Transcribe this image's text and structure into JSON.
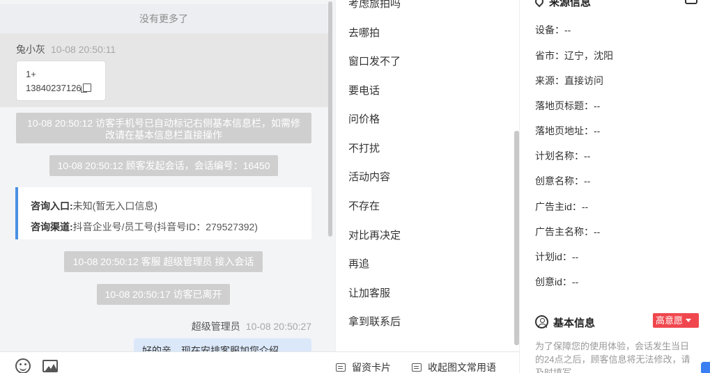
{
  "chat": {
    "no_more": "没有更多了",
    "visitor_message": {
      "sender": "兔小灰",
      "time": "10-08 20:50:11",
      "line1": "1+",
      "line2": "13840237126"
    },
    "system_messages": [
      "10-08 20:50:12 访客手机号已自动标记右侧基本信息栏，如需修改请在基本信息栏直接操作",
      "10-08 20:50:12 顾客发起会话，会话编号：16450",
      "10-08 20:50:12 客服 超级管理员 接入会话",
      "10-08 20:50:17 访客已离开"
    ],
    "info_card": {
      "entry_label": "咨询入口:",
      "entry_value": "未知(暂无入口信息)",
      "channel_label": "咨询渠道:",
      "channel_value": "抖音企业号/员工号(抖音号ID：279527392)"
    },
    "agent_message": {
      "sender": "超级管理员",
      "time": "10-08 20:50:27",
      "text": "好的亲，现在安排客服加您介绍"
    }
  },
  "toolbar": {
    "emoji_icon": "emoji-icon",
    "image_icon": "image-icon",
    "card_label": "留资卡片",
    "collapse_label": "收起图文常用语"
  },
  "quick_replies": [
    "考虑旅拍吗",
    "去哪拍",
    "窗口发不了",
    "要电话",
    "问价格",
    "不打扰",
    "活动内容",
    "不存在",
    "对比再决定",
    "再追",
    "让加客服",
    "拿到联系后"
  ],
  "source_info": {
    "title": "来源信息",
    "rows": [
      "设备：--",
      "省市：辽宁，沈阳",
      "来源：直接访问",
      "落地页标题：--",
      "落地页地址：--",
      "计划名称：--",
      "创意名称：--",
      "广告主id：--",
      "广告主名称：--",
      "计划id：--",
      "创意id：--"
    ]
  },
  "basic_info": {
    "title": "基本信息",
    "intent_badge": "高意愿",
    "note": "为了保障您的使用体验，会话发生当日的24点之后，顾客信息将无法修改，请及时填写"
  },
  "colors": {
    "accent_blue": "#4a90e2",
    "badge_red": "#f0474e",
    "agent_bubble": "#dbe8fa"
  }
}
